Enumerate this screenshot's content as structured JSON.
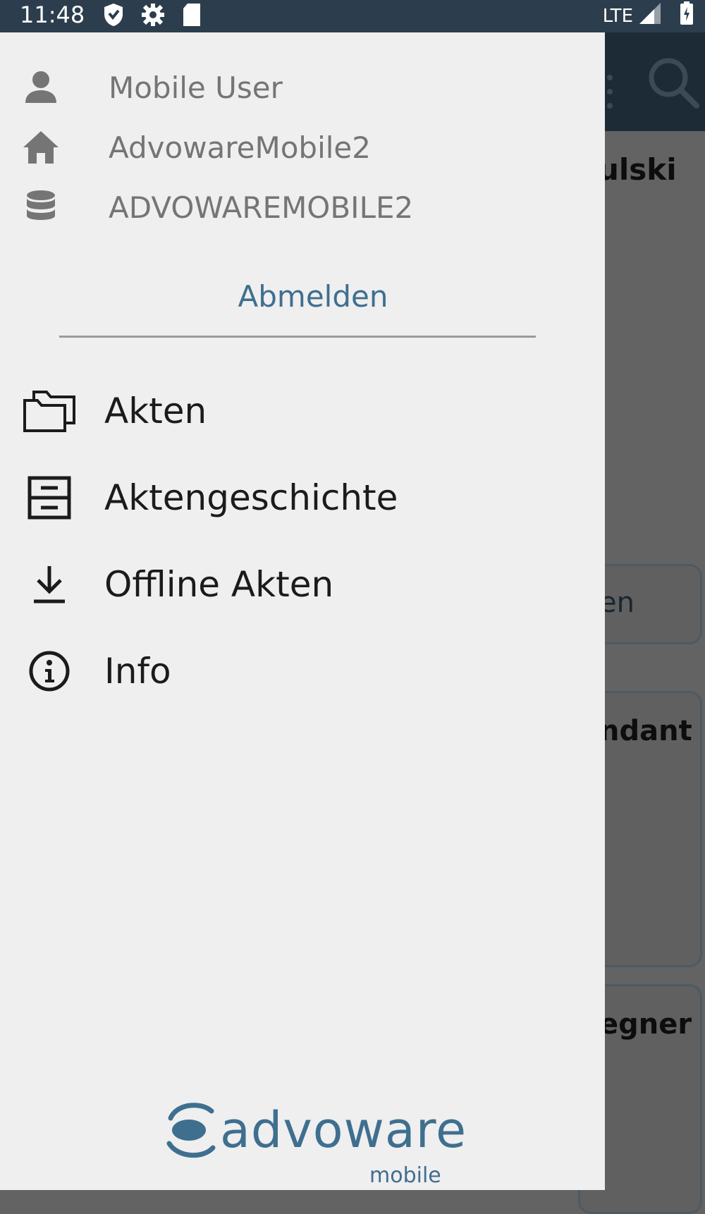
{
  "status_bar": {
    "time": "11:48",
    "network": "LTE",
    "icons": [
      "shield-icon",
      "gear-icon",
      "sd-card-icon",
      "signal-icon",
      "battery-icon"
    ]
  },
  "background": {
    "text_top": "ulski",
    "card1_text": "en",
    "card2_text": "ndant",
    "card3_text": "egner"
  },
  "drawer": {
    "user_name": "Mobile User",
    "workspace": "AdvowareMobile2",
    "database": "ADVOWAREMOBILE2",
    "logout_label": "Abmelden",
    "menu": [
      {
        "label": "Akten",
        "icon": "folders-icon"
      },
      {
        "label": "Aktengeschichte",
        "icon": "archive-icon"
      },
      {
        "label": "Offline Akten",
        "icon": "download-icon"
      },
      {
        "label": "Info",
        "icon": "info-icon"
      }
    ],
    "logo": {
      "name": "advoware",
      "sub": "mobile"
    }
  },
  "colors": {
    "status_bar": "#2c3e4d",
    "drawer_bg": "#efefef",
    "accent": "#3f6f8f",
    "scrim": "#636363"
  }
}
